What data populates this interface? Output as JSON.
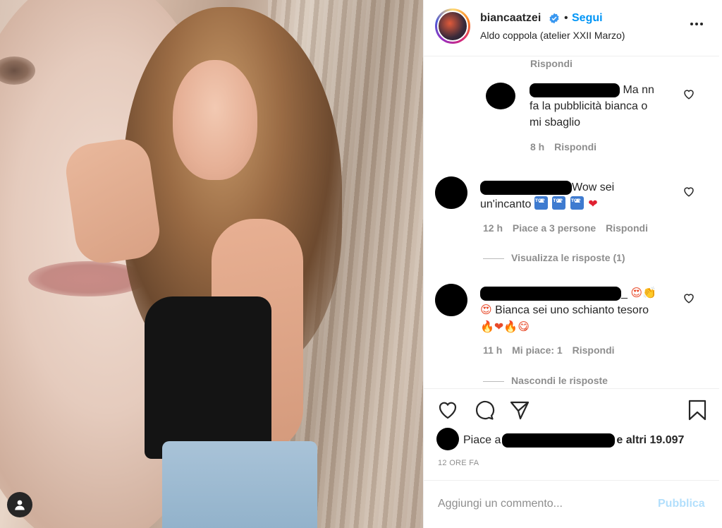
{
  "post": {
    "username": "biancaatzei",
    "follow_label": "Segui",
    "separator": "•",
    "location": "Aldo coppola (atelier XXII Marzo)"
  },
  "comments": {
    "reply_top": "Rispondi",
    "c1": {
      "text_a": "Ma nn",
      "text_b": "fa la pubblicità bianca o",
      "text_c": "mi sbaglio",
      "time": "8 h",
      "reply": "Rispondi"
    },
    "c2": {
      "text_a": "Wow sei",
      "text_b": "un'incanto",
      "heart": "❤",
      "time": "12 h",
      "likes": "Piace a 3 persone",
      "reply": "Rispondi",
      "view_replies": "Visualizza le risposte (1)"
    },
    "c3": {
      "suffix": "_",
      "text_b": "Bianca sei uno schianto tesoro",
      "emoji_a": "😍👏",
      "emoji_b": "😍",
      "emoji_c": "🔥❤🔥😋",
      "time": "11 h",
      "likes": "Mi piace: 1",
      "reply": "Rispondi",
      "hide_replies": "Nascondi le risposte"
    }
  },
  "likes": {
    "prefix": "Piace a",
    "suffix": "e altri 19.097"
  },
  "time_ago": "12 ORE FA",
  "add_comment": {
    "placeholder": "Aggiungi un commento...",
    "publish": "Pubblica"
  },
  "colors": {
    "accent": "#0095f6",
    "publish_disabled": "#b2dffc",
    "muted": "#8e8e8e"
  }
}
